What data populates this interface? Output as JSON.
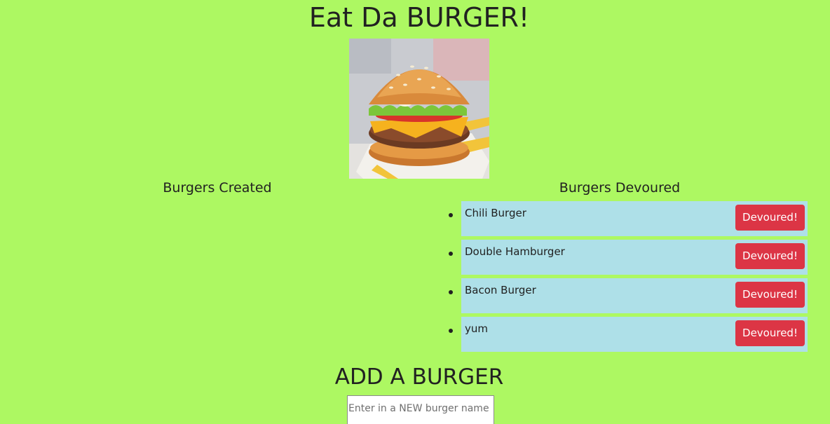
{
  "header": {
    "title": "Eat Da BURGER!"
  },
  "hero_image": {
    "icon": "burger-photo",
    "alt": "burger"
  },
  "columns": {
    "created_heading": "Burgers Created",
    "devoured_heading": "Burgers Devoured"
  },
  "devoured_burgers": [
    {
      "name": "Chili Burger",
      "button_label": "Devoured!"
    },
    {
      "name": "Double Hamburger",
      "button_label": "Devoured!"
    },
    {
      "name": "Bacon Burger",
      "button_label": "Devoured!"
    },
    {
      "name": "yum",
      "button_label": "Devoured!"
    }
  ],
  "add_form": {
    "heading": "ADD A BURGER",
    "input_placeholder": "Enter in a NEW burger name",
    "input_value": ""
  },
  "colors": {
    "page_background": "#adf862",
    "card_background": "#aee0e8",
    "button_danger": "#dc3545",
    "text": "#212121"
  }
}
